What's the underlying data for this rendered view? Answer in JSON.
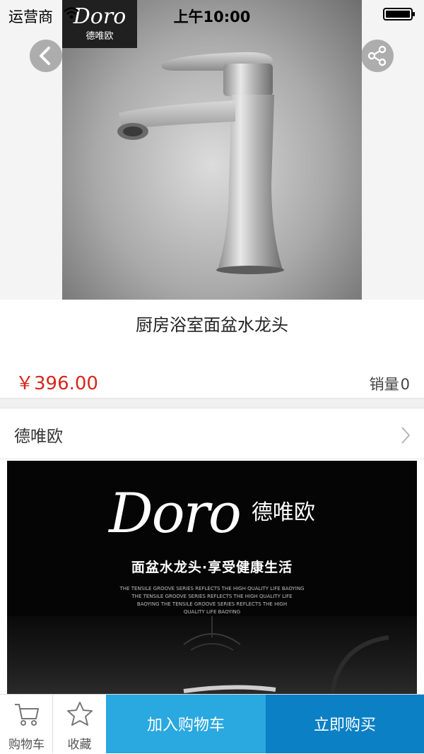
{
  "status_bar": {
    "carrier": "运营商",
    "time": "上午10:00"
  },
  "product": {
    "brand_badge_mark": "Doro",
    "brand_badge_cn": "德唯欧",
    "title": "厨房浴室面盆水龙头",
    "price": "￥396.00",
    "sales_label": "销量",
    "sales_count": "0"
  },
  "shop": {
    "name": "德唯欧"
  },
  "detail_banner": {
    "logo_mark": "Doro",
    "logo_cn": "德唯欧",
    "slogan": "面盆水龙头·享受健康生活",
    "small_text_lines": [
      "THE TENSILE GROOVE SERIES REFLECTS THE HIGH QUALITY LIFE BAOYING",
      "THE TENSILE GROOVE SERIES REFLECTS THE HIGH QUALITY LIFE",
      "BAOYING THE TENSILE GROOVE SERIES REFLECTS THE HIGH",
      "QUALITY LIFE BAOYING"
    ]
  },
  "bottom_bar": {
    "cart_label": "购物车",
    "favorite_label": "收藏",
    "add_to_cart_label": "加入购物车",
    "buy_now_label": "立即购买"
  },
  "colors": {
    "price": "#d5281e",
    "add_to_cart_bg": "#2aa8e0",
    "buy_now_bg": "#0b80c5"
  },
  "icons": [
    "wifi-icon",
    "battery-icon",
    "back-icon",
    "share-icon",
    "chevron-right-icon",
    "cart-icon",
    "star-icon"
  ]
}
